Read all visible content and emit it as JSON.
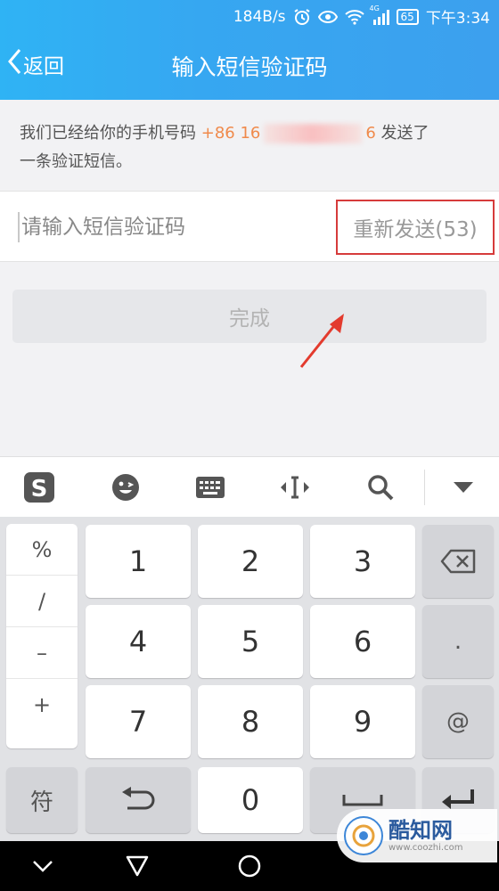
{
  "status_bar": {
    "speed": "184B/s",
    "network_tag": "4G",
    "battery": "65",
    "time": "下午3:34"
  },
  "nav": {
    "back_label": "返回",
    "title": "输入短信验证码"
  },
  "info": {
    "line_before": "我们已经给你的手机号码",
    "phone_prefix": "+86 16",
    "phone_suffix": "6",
    "line_after": "发送了",
    "line2": "一条验证短信。"
  },
  "code_input": {
    "placeholder": "请输入短信验证码",
    "value": ""
  },
  "resend_label": "重新发送(53)",
  "done_label": "完成",
  "keyboard": {
    "toolbar_icons": [
      "sogou-logo-icon",
      "emoji-icon",
      "keyboard-icon",
      "cursor-move-icon",
      "search-icon",
      "collapse-icon"
    ],
    "symbols": [
      "%",
      "/",
      "–",
      "+"
    ],
    "digits": [
      "1",
      "2",
      "3",
      "4",
      "5",
      "6",
      "7",
      "8",
      "9",
      "0"
    ],
    "dot": ".",
    "at": "@",
    "symbols_key": "符"
  },
  "watermark": {
    "name": "酷知网",
    "url": "www.coozhi.com"
  },
  "colors": {
    "header_gradient_start": "#2fb3f4",
    "header_gradient_end": "#3ca0ee",
    "phone_highlight": "#f08a4b",
    "annotation_red": "#d63b3b"
  }
}
